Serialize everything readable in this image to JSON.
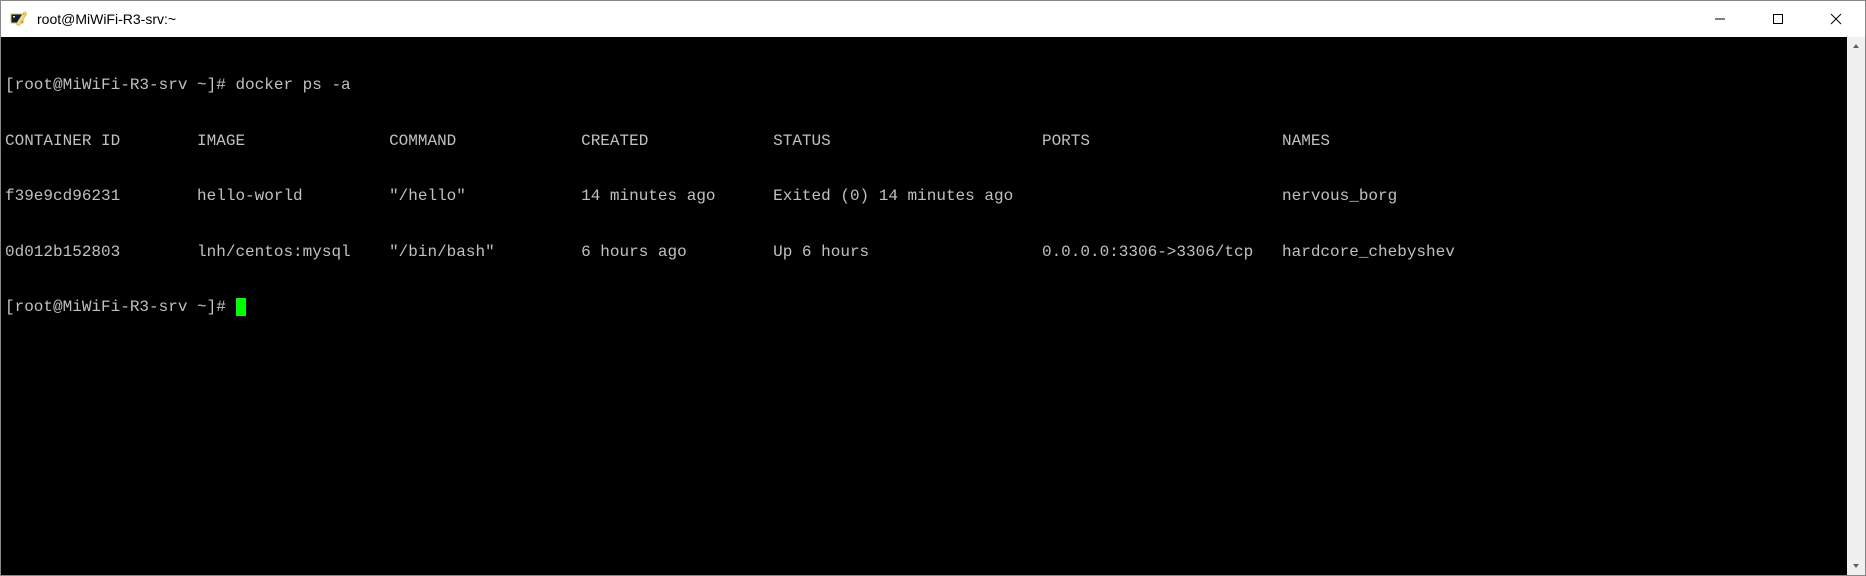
{
  "window": {
    "title": "root@MiWiFi-R3-srv:~"
  },
  "terminal": {
    "prompt": "[root@MiWiFi-R3-srv ~]#",
    "command1": "docker ps -a",
    "header": {
      "container_id": "CONTAINER ID",
      "image": "IMAGE",
      "command": "COMMAND",
      "created": "CREATED",
      "status": "STATUS",
      "ports": "PORTS",
      "names": "NAMES"
    },
    "rows": [
      {
        "container_id": "f39e9cd96231",
        "image": "hello-world",
        "command": "\"/hello\"",
        "created": "14 minutes ago",
        "status": "Exited (0) 14 minutes ago",
        "ports": "",
        "names": "nervous_borg"
      },
      {
        "container_id": "0d012b152803",
        "image": "lnh/centos:mysql",
        "command": "\"/bin/bash\"",
        "created": "6 hours ago",
        "status": "Up 6 hours",
        "ports": "0.0.0.0:3306->3306/tcp",
        "names": "hardcore_chebyshev"
      }
    ],
    "line1": "[root@MiWiFi-R3-srv ~]# docker ps -a",
    "line2": "CONTAINER ID        IMAGE               COMMAND             CREATED             STATUS                      PORTS                    NAMES",
    "line3": "f39e9cd96231        hello-world         \"/hello\"            14 minutes ago      Exited (0) 14 minutes ago                            nervous_borg",
    "line4": "0d012b152803        lnh/centos:mysql    \"/bin/bash\"         6 hours ago         Up 6 hours                  0.0.0.0:3306->3306/tcp   hardcore_chebyshev",
    "line5": "[root@MiWiFi-R3-srv ~]# "
  }
}
